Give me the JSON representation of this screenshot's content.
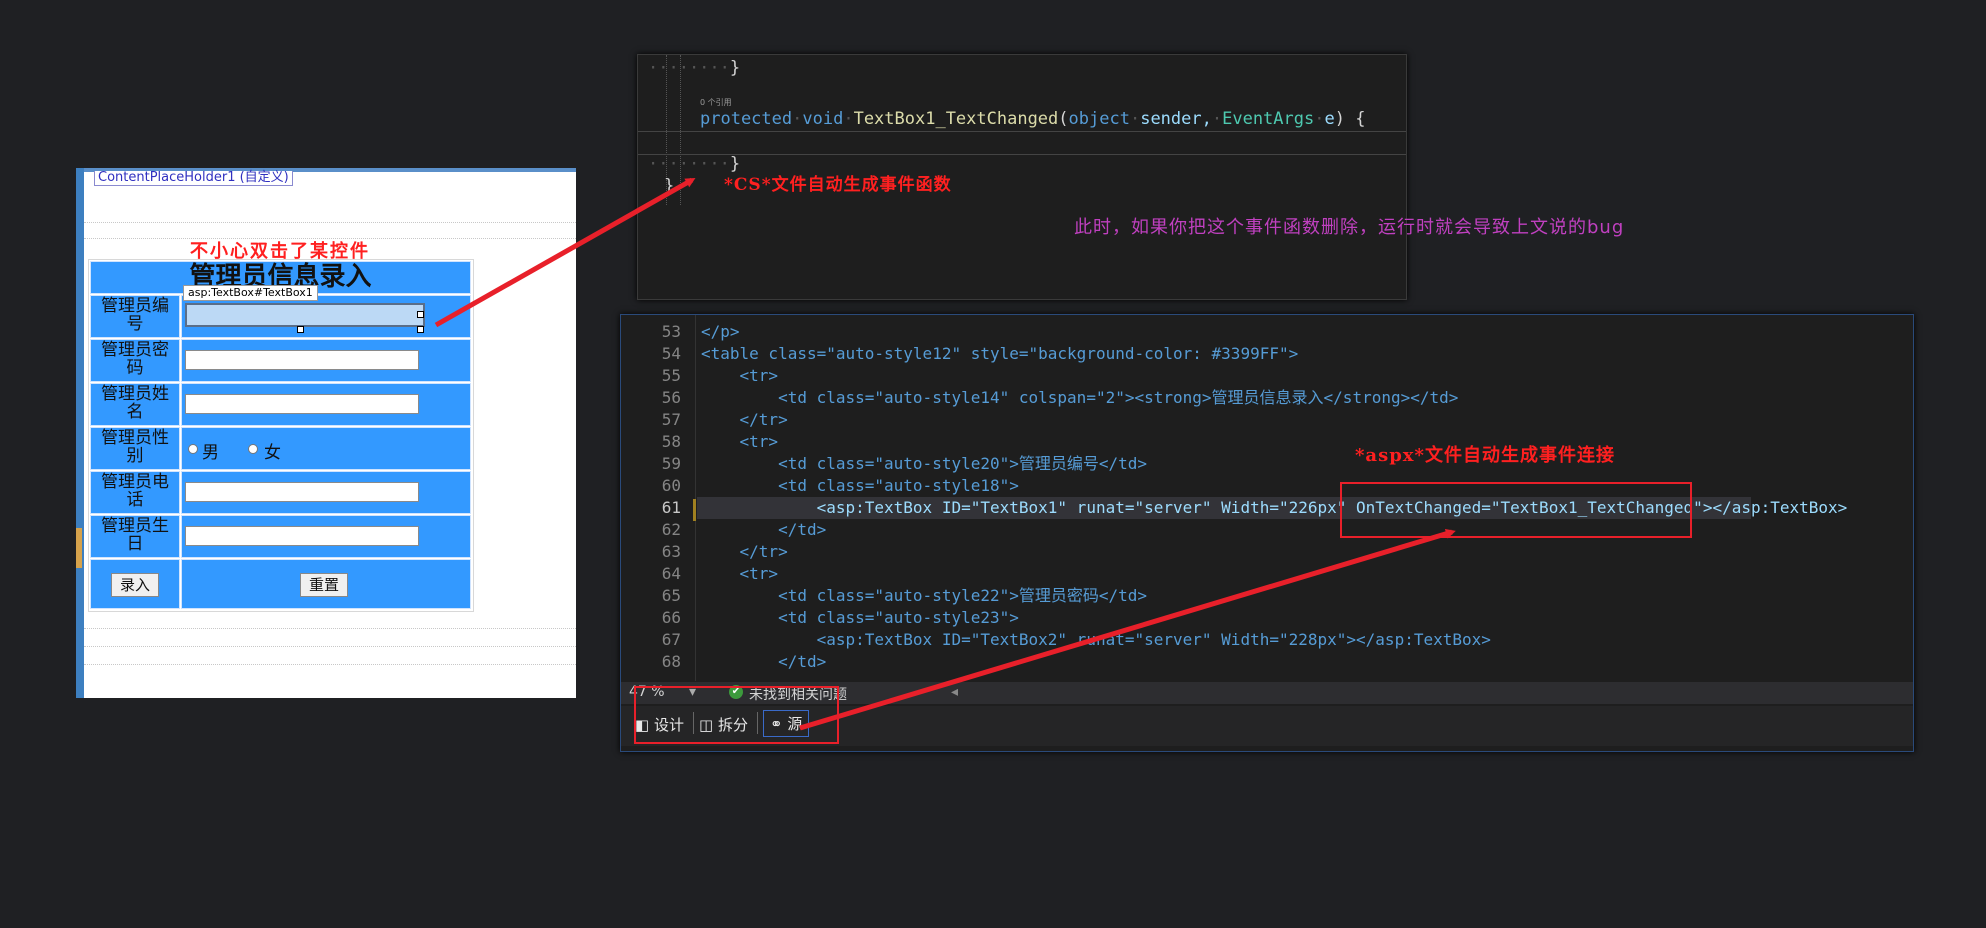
{
  "designer": {
    "placeholder_label": "ContentPlaceHolder1 (自定义)",
    "note": "不小心双击了某控件",
    "tooltip": "asp:TextBox#TextBox1",
    "form": {
      "title": "管理员信息录入",
      "rows": [
        {
          "label_line1": "管理员编",
          "label_line2": "号"
        },
        {
          "label_line1": "管理员密",
          "label_line2": "码"
        },
        {
          "label_line1": "管理员姓",
          "label_line2": "名"
        },
        {
          "label_line1": "管理员性",
          "label_line2": "别"
        },
        {
          "label_line1": "管理员电",
          "label_line2": "话"
        },
        {
          "label_line1": "管理员生",
          "label_line2": "日"
        }
      ],
      "gender_options": [
        "男",
        "女"
      ],
      "submit_label": "录入",
      "reset_label": "重置"
    }
  },
  "cs_panel": {
    "line_brace1": "}",
    "ref_hint": "0 个引用",
    "sig_kw1": "protected",
    "sig_kw2": "void",
    "sig_name": "TextBox1_TextChanged",
    "sig_open": "(",
    "sig_t1": "object",
    "sig_p1": "sender,",
    "sig_t2": "EventArgs",
    "sig_p2": "e",
    "sig_close": ") {",
    "line_brace2": "}",
    "line_brace3": "}",
    "note_red": "*CS*文件自动生成事件函数",
    "note_purple": "此时，如果你把这个事件函数删除，运行时就会导致上文说的bug"
  },
  "aspx_panel": {
    "lines": [
      {
        "num": "53",
        "text": "</p>"
      },
      {
        "num": "54",
        "text": "<table class=\"auto-style12\" style=\"background-color: #3399FF\">"
      },
      {
        "num": "55",
        "text": "    <tr>"
      },
      {
        "num": "56",
        "text": "        <td class=\"auto-style14\" colspan=\"2\"><strong>管理员信息录入</strong></td>"
      },
      {
        "num": "57",
        "text": "    </tr>"
      },
      {
        "num": "58",
        "text": "    <tr>"
      },
      {
        "num": "59",
        "text": "        <td class=\"auto-style20\">管理员编号</td>"
      },
      {
        "num": "60",
        "text": "        <td class=\"auto-style18\">"
      },
      {
        "num": "61",
        "text": "            <asp:TextBox ID=\"TextBox1\" runat=\"server\" Width=\"226px\" OnTextChanged=\"TextBox1_TextChanged\"></asp:TextBox>"
      },
      {
        "num": "62",
        "text": "        </td>"
      },
      {
        "num": "63",
        "text": "    </tr>"
      },
      {
        "num": "64",
        "text": "    <tr>"
      },
      {
        "num": "65",
        "text": "        <td class=\"auto-style22\">管理员密码</td>"
      },
      {
        "num": "66",
        "text": "        <td class=\"auto-style23\">"
      },
      {
        "num": "67",
        "text": "            <asp:TextBox ID=\"TextBox2\" runat=\"server\" Width=\"228px\"></asp:TextBox>"
      },
      {
        "num": "68",
        "text": "        </td>"
      }
    ],
    "note_red": "*aspx*文件自动生成事件连接",
    "zoom": "47 %",
    "status": "未找到相关问题",
    "view_tabs": [
      "设计",
      "拆分",
      "源"
    ]
  },
  "colors": {
    "accent_red": "#e8202a",
    "form_blue": "#3399FF",
    "note_purple": "#c040c0"
  }
}
